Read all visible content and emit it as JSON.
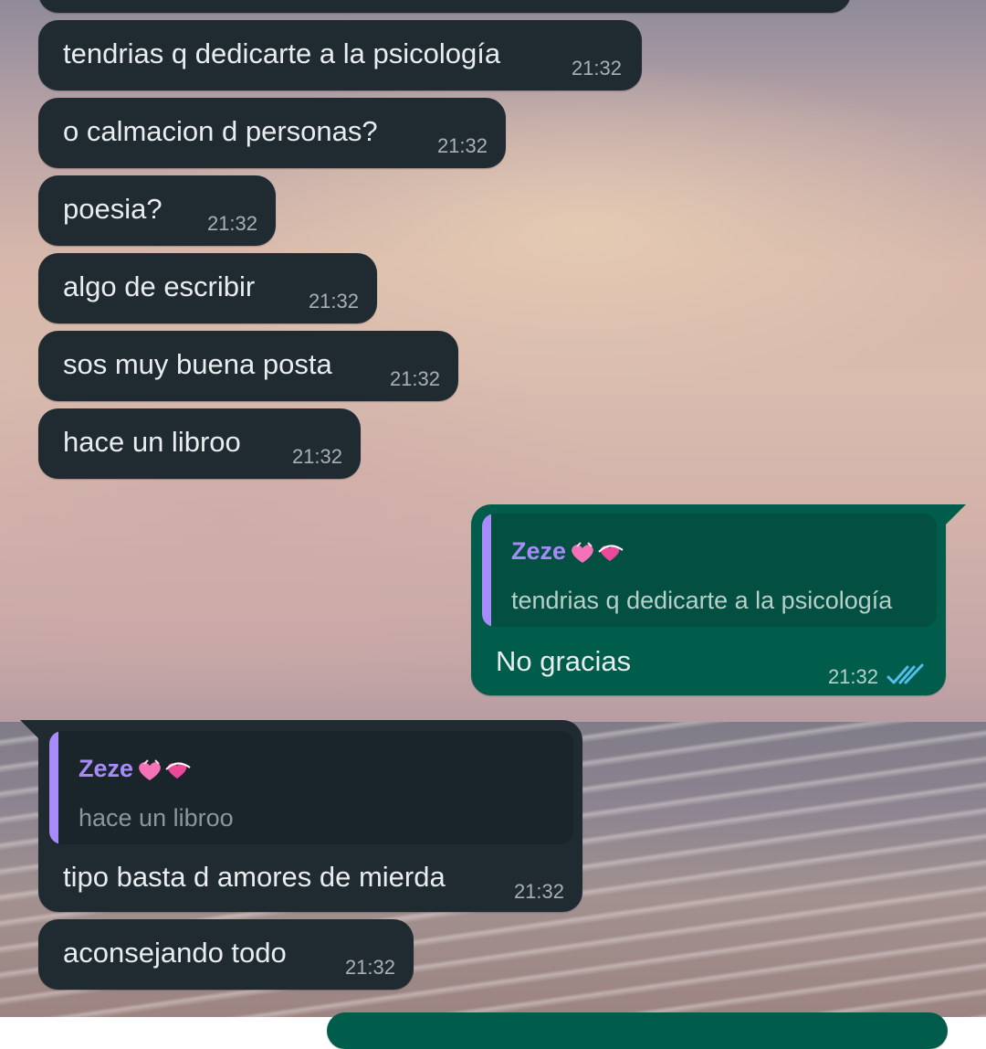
{
  "chat": {
    "incoming_1": {
      "text": "tendrias q dedicarte a la psicología",
      "time": "21:32"
    },
    "incoming_2": {
      "text": "o calmacion d personas?",
      "time": "21:32"
    },
    "incoming_3": {
      "text": "poesia?",
      "time": "21:32"
    },
    "incoming_4": {
      "text": "algo de escribir",
      "time": "21:32"
    },
    "incoming_5": {
      "text": "sos muy buena posta",
      "time": "21:32"
    },
    "incoming_6": {
      "text": "hace un libroo",
      "time": "21:32"
    },
    "outgoing_reply": {
      "quoted_author": "Zeze",
      "quoted_text": "tendrias q dedicarte a la psicología",
      "text": "No gracias",
      "time": "21:32",
      "status_icon": "double-check-read-icon"
    },
    "incoming_reply": {
      "quoted_author": "Zeze",
      "quoted_text": "hace un libroo",
      "text": "tipo basta d amores de mierda",
      "time": "21:32"
    },
    "incoming_7": {
      "text": "aconsejando todo",
      "time": "21:32"
    }
  },
  "colors": {
    "incoming_bubble": "#1f2a31",
    "outgoing_bubble": "#005c4b",
    "quote_accent": "#a78bfa",
    "read_ticks": "#53bdeb"
  }
}
